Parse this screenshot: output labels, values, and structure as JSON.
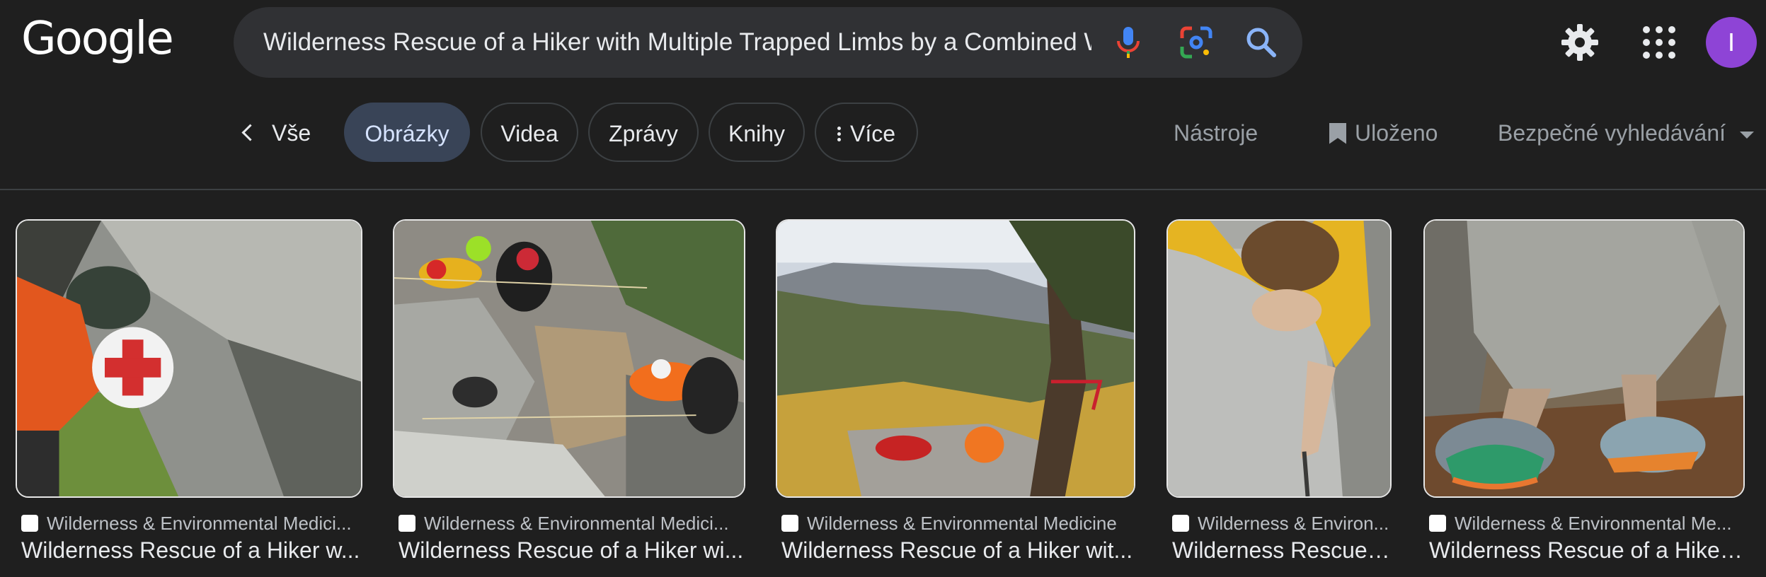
{
  "header": {
    "logo_text": "Google",
    "search_value": "Wilderness Rescue of a Hiker with Multiple Trapped Limbs by a Combined W",
    "icons": [
      "microphone-icon",
      "google-lens-icon",
      "search-icon"
    ],
    "settings_icon": "gear-icon",
    "apps_icon": "apps-grid-icon",
    "avatar_letter": "I"
  },
  "nav": {
    "back_label": "Vše",
    "tabs": [
      "Obrázky",
      "Videa",
      "Zprávy",
      "Knihy",
      "Více"
    ],
    "active_tab": "Obrázky",
    "tools_label": "Nástroje",
    "saved_label": "Uloženo",
    "safesearch_label": "Bezpečné vyhledávání"
  },
  "results": [
    {
      "source": "Wilderness & Environmental Medici...",
      "title": "Wilderness Rescue of a Hiker w..."
    },
    {
      "source": "Wilderness & Environmental Medici...",
      "title": "Wilderness Rescue of a Hiker wi..."
    },
    {
      "source": "Wilderness & Environmental Medicine",
      "title": "Wilderness Rescue of a Hiker wit..."
    },
    {
      "source": "Wilderness & Environ...",
      "title": "Wilderness Rescue ..."
    },
    {
      "source": "Wilderness & Environmental Me...",
      "title": "Wilderness Rescue of a Hiker..."
    }
  ],
  "colors": {
    "background": "#1f1f1f",
    "search_box": "#303134",
    "active_chip": "#394457",
    "avatar": "#8e44d6"
  }
}
